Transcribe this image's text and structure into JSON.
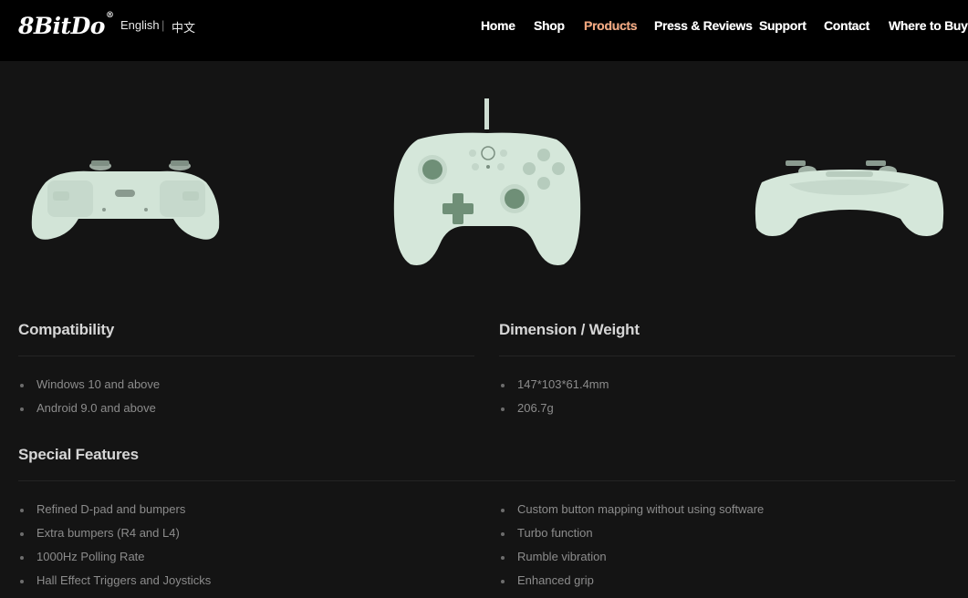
{
  "header": {
    "logo": "8BitDo",
    "logo_mark": "®",
    "lang_english": "English",
    "lang_separator": "|",
    "lang_chinese": "中文",
    "nav": [
      "Home",
      "Shop",
      "Products",
      "Press & Reviews",
      "Support",
      "Contact",
      "Where to Buy"
    ],
    "active_nav": "Products",
    "accent_color": "#f0a37a"
  },
  "product_images": [
    "controller-back-view",
    "controller-front-view",
    "controller-top-view"
  ],
  "controller_color": "#d5e7da",
  "sections": {
    "compatibility": {
      "title": "Compatibility",
      "items": [
        "Windows 10 and above",
        "Android 9.0 and above"
      ]
    },
    "dimension": {
      "title": "Dimension / Weight",
      "items": [
        "147*103*61.4mm",
        "206.7g"
      ]
    },
    "features": {
      "title": "Special Features",
      "left": [
        "Refined D-pad and bumpers",
        "Extra bumpers (R4 and L4)",
        "1000Hz Polling Rate",
        "Hall Effect Triggers and Joysticks"
      ],
      "right": [
        "Custom button mapping without using software",
        "Turbo function",
        "Rumble vibration",
        "Enhanced grip"
      ]
    }
  }
}
